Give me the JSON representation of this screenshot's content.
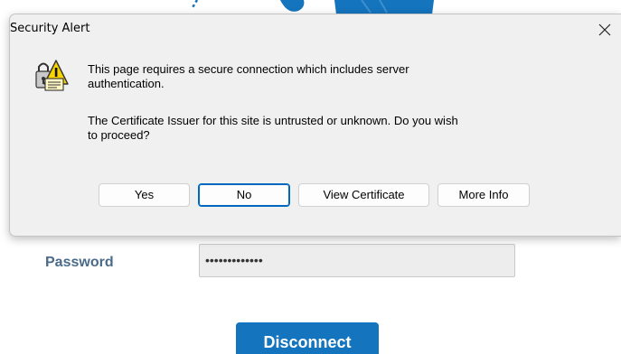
{
  "dialog": {
    "title": "Security Alert",
    "message_1": "This page requires a secure connection which includes server authentication.",
    "message_2": "The Certificate Issuer for this site is untrusted or unknown.  Do you wish to proceed?",
    "buttons": {
      "yes": "Yes",
      "no": "No",
      "view_certificate": "View Certificate",
      "more_info": "More Info"
    },
    "icon": "certificate-warning-icon",
    "close_icon": "close-icon"
  },
  "login_form": {
    "password_label": "Password",
    "password_value": "•••••••••••••",
    "disconnect_label": "Disconnect"
  },
  "colors": {
    "accent": "#1474bd",
    "label": "#4a6b8a",
    "dialog_bg": "#f0f0f0",
    "focus": "#0067c0"
  }
}
